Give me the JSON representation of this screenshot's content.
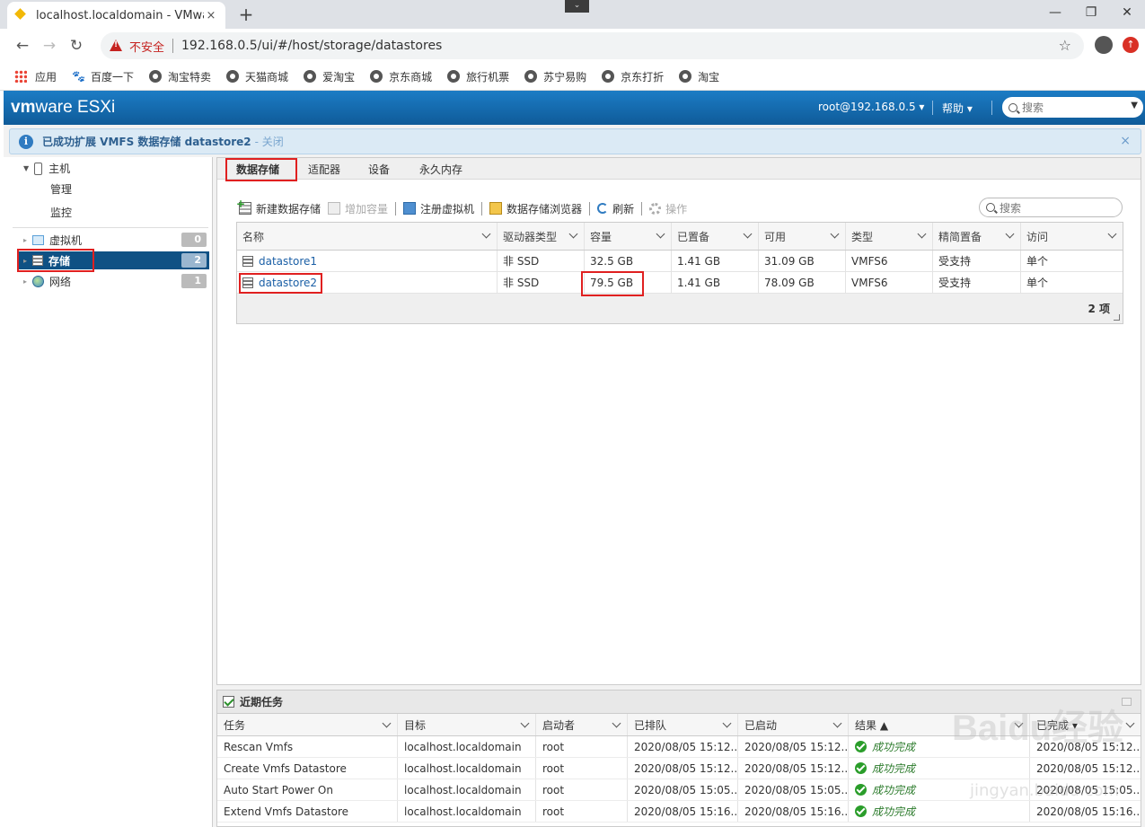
{
  "browser": {
    "tab_title": "localhost.localdomain - VMware ESXi",
    "tab_close": "×",
    "new_tab": "+",
    "insecure_label": "不安全",
    "url": "192.168.0.5/ui/#/host/storage/datastores",
    "bookmarks": [
      "应用",
      "百度一下",
      "淘宝特卖",
      "天猫商城",
      "爱淘宝",
      "京东商城",
      "旅行机票",
      "苏宁易购",
      "京东打折",
      "淘宝"
    ]
  },
  "header": {
    "logo_vm": "vm",
    "logo_rest": "ware",
    "logo_product": "ESXi",
    "user": "root@192.168.0.5 ▾",
    "help": "帮助 ▾",
    "search_placeholder": "搜索"
  },
  "notice": {
    "text": "已成功扩展 VMFS 数据存储 datastore2",
    "close_link": "- 关闭",
    "close_x": "×"
  },
  "sidebar": {
    "host_label": "主机",
    "manage": "管理",
    "monitor": "监控",
    "items": [
      {
        "label": "虚拟机",
        "count": "0"
      },
      {
        "label": "存储",
        "count": "2"
      },
      {
        "label": "网络",
        "count": "1"
      }
    ]
  },
  "tabs": [
    "数据存储",
    "适配器",
    "设备",
    "永久内存"
  ],
  "actions": {
    "new": "新建数据存储",
    "increase": "增加容量",
    "register": "注册虚拟机",
    "browser": "数据存储浏览器",
    "refresh": "刷新",
    "ops": "操作",
    "search_placeholder": "搜索"
  },
  "table": {
    "columns": [
      "名称",
      "驱动器类型",
      "容量",
      "已置备",
      "可用",
      "类型",
      "精简置备",
      "访问"
    ],
    "rows": [
      [
        "datastore1",
        "非 SSD",
        "32.5 GB",
        "1.41 GB",
        "31.09 GB",
        "VMFS6",
        "受支持",
        "单个"
      ],
      [
        "datastore2",
        "非 SSD",
        "79.5 GB",
        "1.41 GB",
        "78.09 GB",
        "VMFS6",
        "受支持",
        "单个"
      ]
    ],
    "count": "2 项"
  },
  "tasks": {
    "title": "近期任务",
    "columns": [
      "任务",
      "目标",
      "启动者",
      "已排队",
      "已启动",
      "结果 ▲",
      "已完成 ▾"
    ],
    "rows": [
      [
        "Rescan Vmfs",
        "localhost.localdomain",
        "root",
        "2020/08/05 15:12...",
        "2020/08/05 15:12...",
        "成功完成",
        "2020/08/05 15:12..."
      ],
      [
        "Create Vmfs Datastore",
        "localhost.localdomain",
        "root",
        "2020/08/05 15:12...",
        "2020/08/05 15:12...",
        "成功完成",
        "2020/08/05 15:12..."
      ],
      [
        "Auto Start Power On",
        "localhost.localdomain",
        "root",
        "2020/08/05 15:05...",
        "2020/08/05 15:05...",
        "成功完成",
        "2020/08/05 15:05..."
      ],
      [
        "Extend Vmfs Datastore",
        "localhost.localdomain",
        "root",
        "2020/08/05 15:16...",
        "2020/08/05 15:16...",
        "成功完成",
        "2020/08/05 15:16..."
      ]
    ]
  },
  "watermark": {
    "logo": "Baidu经验",
    "url": "jingyan.baidu.com"
  },
  "colors": {
    "accent": "#0f5b99",
    "highlight": "#e02020",
    "success": "#2a9d2a"
  }
}
